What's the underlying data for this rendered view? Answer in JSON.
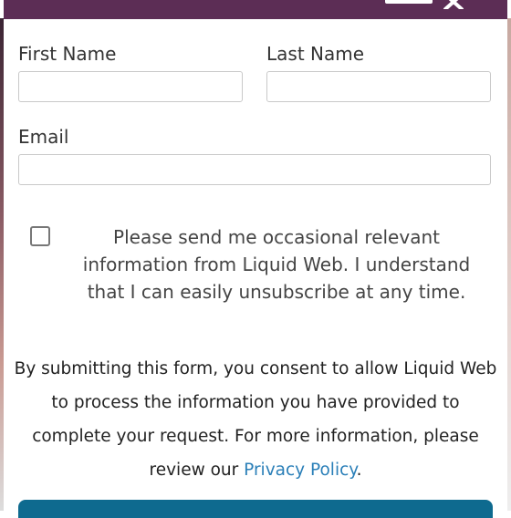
{
  "form": {
    "first_name_label": "First Name",
    "last_name_label": "Last Name",
    "email_label": "Email",
    "first_name_value": "",
    "last_name_value": "",
    "email_value": ""
  },
  "consent": {
    "text": "Please send me occasional relevant information from Liquid Web. I understand that I can easily unsubscribe at any time.",
    "checked": false
  },
  "disclaimer": {
    "text_before": "By submitting this form, you consent to allow Liquid Web to process the information you have provided to complete your request. For more information, please review our ",
    "link_text": "Privacy Policy",
    "text_after": "."
  },
  "colors": {
    "header": "#5c2d55",
    "link": "#2a7fb8",
    "submit_button": "#0e6a8f"
  },
  "icons": {
    "close": "close-icon"
  }
}
